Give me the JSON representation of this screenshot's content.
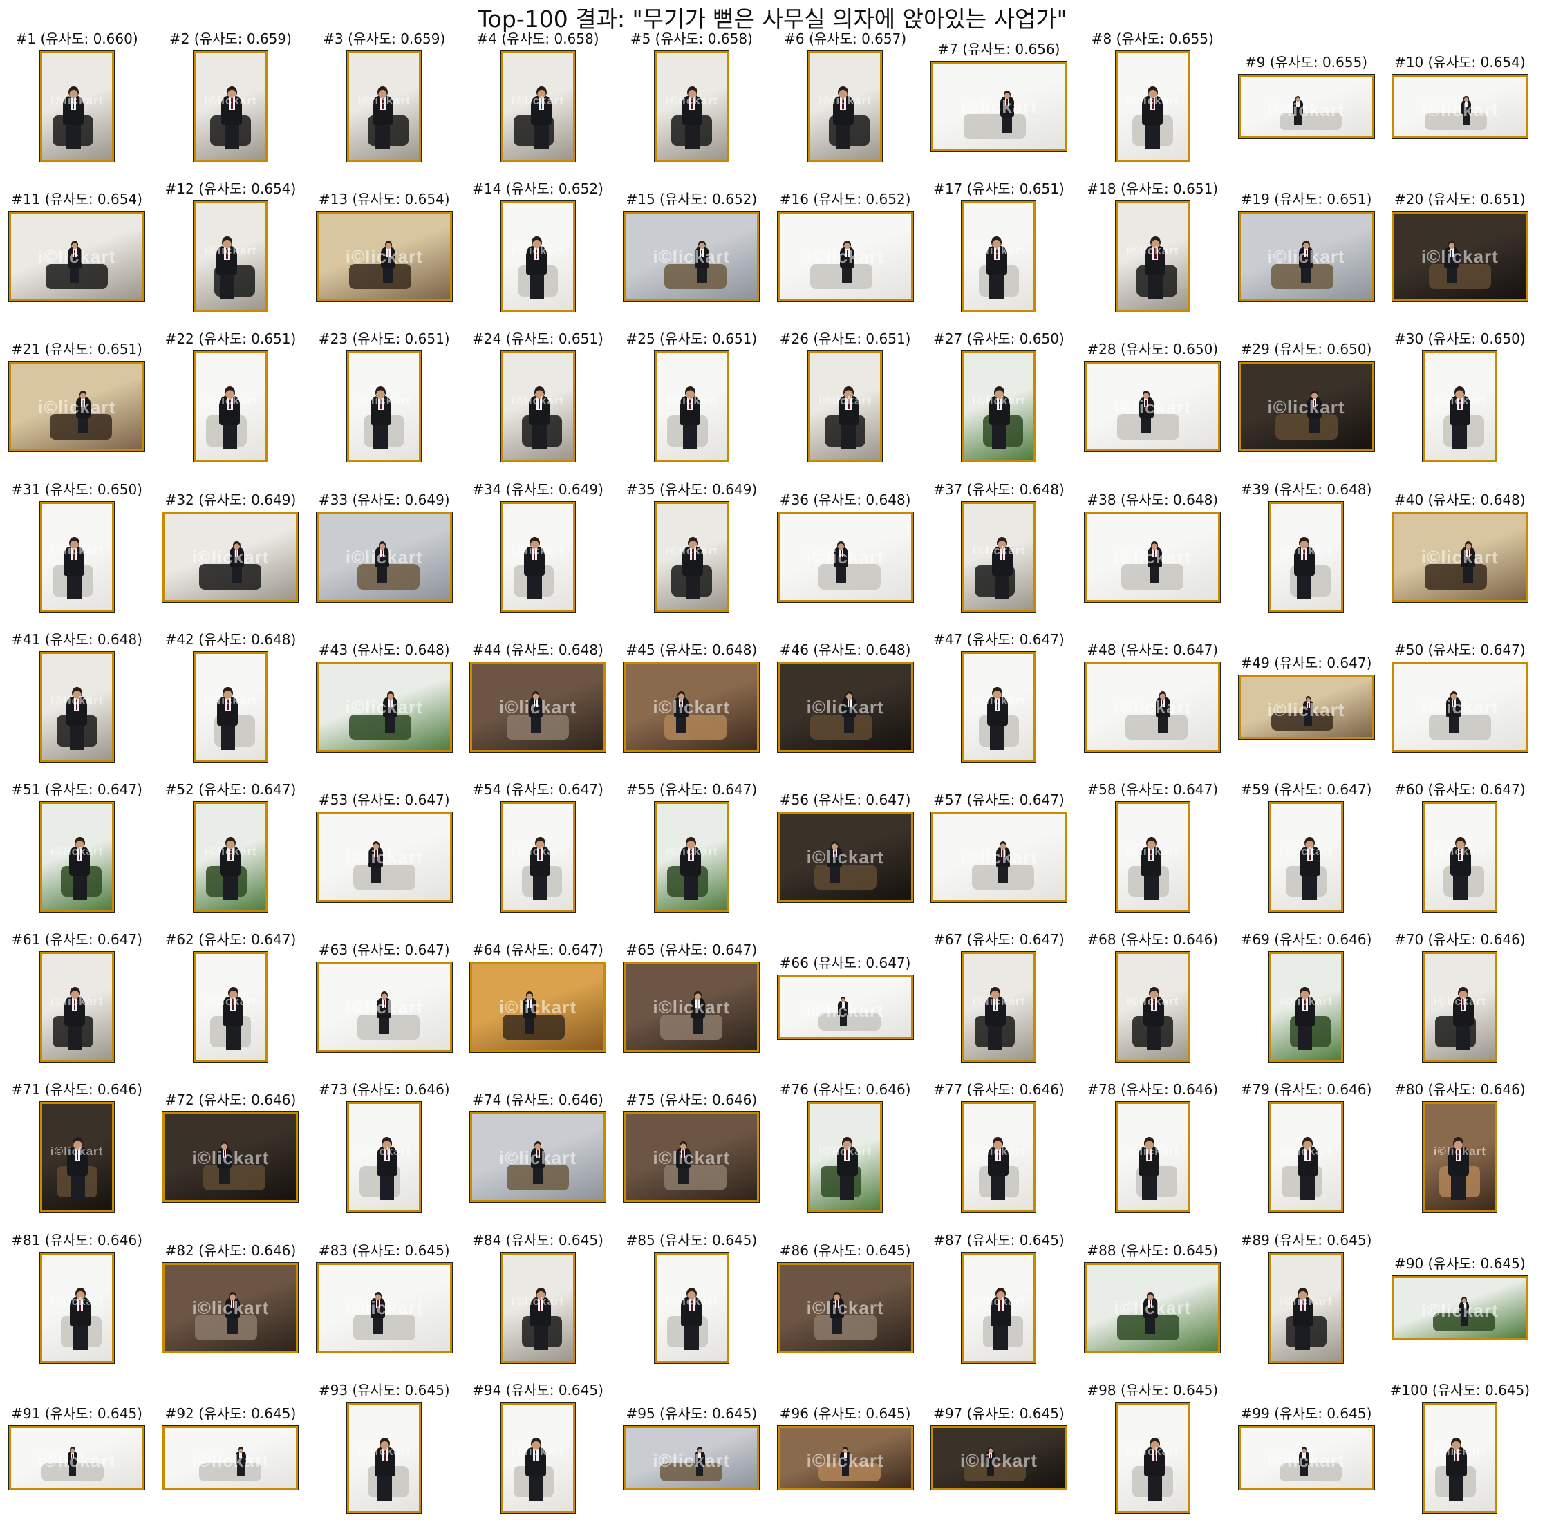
{
  "title": "Top-100 결과: \"무기가 뻗은 사무실 의자에 앉아있는 사업가\"",
  "caption_prefix": "유사도",
  "watermark": "i©lickart",
  "accent_border": "#c98a00",
  "results": [
    {
      "rank": 1,
      "score": "0.660",
      "orient": "p",
      "theme": "studio",
      "label": "#1 (유사도: 0.660)"
    },
    {
      "rank": 2,
      "score": "0.659",
      "orient": "p",
      "theme": "studio",
      "label": "#2 (유사도: 0.659)"
    },
    {
      "rank": 3,
      "score": "0.659",
      "orient": "p",
      "theme": "studio",
      "label": "#3 (유사도: 0.659)"
    },
    {
      "rank": 4,
      "score": "0.658",
      "orient": "p",
      "theme": "studio",
      "label": "#4 (유사도: 0.658)"
    },
    {
      "rank": 5,
      "score": "0.658",
      "orient": "p",
      "theme": "studio",
      "label": "#5 (유사도: 0.658)"
    },
    {
      "rank": 6,
      "score": "0.657",
      "orient": "p",
      "theme": "studio",
      "label": "#6 (유사도: 0.657)"
    },
    {
      "rank": 7,
      "score": "0.656",
      "orient": "l",
      "theme": "white",
      "label": "#7 (유사도: 0.656)"
    },
    {
      "rank": 8,
      "score": "0.655",
      "orient": "p",
      "theme": "white",
      "label": "#8 (유사도: 0.655)"
    },
    {
      "rank": 9,
      "score": "0.655",
      "orient": "w",
      "theme": "white",
      "label": "#9 (유사도: 0.655)"
    },
    {
      "rank": 10,
      "score": "0.654",
      "orient": "w",
      "theme": "white",
      "label": "#10 (유사도: 0.654)"
    },
    {
      "rank": 11,
      "score": "0.654",
      "orient": "l",
      "theme": "studio",
      "label": "#11 (유사도: 0.654)"
    },
    {
      "rank": 12,
      "score": "0.654",
      "orient": "p",
      "theme": "studio",
      "label": "#12 (유사도: 0.654)"
    },
    {
      "rank": 13,
      "score": "0.654",
      "orient": "l",
      "theme": "warm",
      "label": "#13 (유사도: 0.654)"
    },
    {
      "rank": 14,
      "score": "0.652",
      "orient": "p",
      "theme": "white",
      "label": "#14 (유사도: 0.652)"
    },
    {
      "rank": 15,
      "score": "0.652",
      "orient": "l",
      "theme": "grey",
      "label": "#15 (유사도: 0.652)"
    },
    {
      "rank": 16,
      "score": "0.652",
      "orient": "l",
      "theme": "white",
      "label": "#16 (유사도: 0.652)"
    },
    {
      "rank": 17,
      "score": "0.651",
      "orient": "p",
      "theme": "white",
      "label": "#17 (유사도: 0.651)"
    },
    {
      "rank": 18,
      "score": "0.651",
      "orient": "p",
      "theme": "studio",
      "label": "#18 (유사도: 0.651)"
    },
    {
      "rank": 19,
      "score": "0.651",
      "orient": "l",
      "theme": "grey",
      "label": "#19 (유사도: 0.651)"
    },
    {
      "rank": 20,
      "score": "0.651",
      "orient": "l",
      "theme": "dark",
      "label": "#20 (유사도: 0.651)"
    },
    {
      "rank": 21,
      "score": "0.651",
      "orient": "l",
      "theme": "warm",
      "label": "#21 (유사도: 0.651)"
    },
    {
      "rank": 22,
      "score": "0.651",
      "orient": "p",
      "theme": "white",
      "label": "#22 (유사도: 0.651)"
    },
    {
      "rank": 23,
      "score": "0.651",
      "orient": "p",
      "theme": "white",
      "label": "#23 (유사도: 0.651)"
    },
    {
      "rank": 24,
      "score": "0.651",
      "orient": "p",
      "theme": "studio",
      "label": "#24 (유사도: 0.651)"
    },
    {
      "rank": 25,
      "score": "0.651",
      "orient": "p",
      "theme": "white",
      "label": "#25 (유사도: 0.651)"
    },
    {
      "rank": 26,
      "score": "0.651",
      "orient": "p",
      "theme": "studio",
      "label": "#26 (유사도: 0.651)"
    },
    {
      "rank": 27,
      "score": "0.650",
      "orient": "p",
      "theme": "green",
      "label": "#27 (유사도: 0.650)"
    },
    {
      "rank": 28,
      "score": "0.650",
      "orient": "l",
      "theme": "white",
      "label": "#28 (유사도: 0.650)"
    },
    {
      "rank": 29,
      "score": "0.650",
      "orient": "l",
      "theme": "dark",
      "label": "#29 (유사도: 0.650)"
    },
    {
      "rank": 30,
      "score": "0.650",
      "orient": "p",
      "theme": "white",
      "label": "#30 (유사도: 0.650)"
    },
    {
      "rank": 31,
      "score": "0.650",
      "orient": "p",
      "theme": "white",
      "label": "#31 (유사도: 0.650)"
    },
    {
      "rank": 32,
      "score": "0.649",
      "orient": "l",
      "theme": "studio",
      "label": "#32 (유사도: 0.649)"
    },
    {
      "rank": 33,
      "score": "0.649",
      "orient": "l",
      "theme": "grey",
      "label": "#33 (유사도: 0.649)"
    },
    {
      "rank": 34,
      "score": "0.649",
      "orient": "p",
      "theme": "white",
      "label": "#34 (유사도: 0.649)"
    },
    {
      "rank": 35,
      "score": "0.649",
      "orient": "p",
      "theme": "studio",
      "label": "#35 (유사도: 0.649)"
    },
    {
      "rank": 36,
      "score": "0.648",
      "orient": "l",
      "theme": "white",
      "label": "#36 (유사도: 0.648)"
    },
    {
      "rank": 37,
      "score": "0.648",
      "orient": "p",
      "theme": "studio",
      "label": "#37 (유사도: 0.648)"
    },
    {
      "rank": 38,
      "score": "0.648",
      "orient": "l",
      "theme": "white",
      "label": "#38 (유사도: 0.648)"
    },
    {
      "rank": 39,
      "score": "0.648",
      "orient": "p",
      "theme": "white",
      "label": "#39 (유사도: 0.648)"
    },
    {
      "rank": 40,
      "score": "0.648",
      "orient": "l",
      "theme": "warm",
      "label": "#40 (유사도: 0.648)"
    },
    {
      "rank": 41,
      "score": "0.648",
      "orient": "p",
      "theme": "studio",
      "label": "#41 (유사도: 0.648)"
    },
    {
      "rank": 42,
      "score": "0.648",
      "orient": "p",
      "theme": "white",
      "label": "#42 (유사도: 0.648)"
    },
    {
      "rank": 43,
      "score": "0.648",
      "orient": "l",
      "theme": "green",
      "label": "#43 (유사도: 0.648)"
    },
    {
      "rank": 44,
      "score": "0.648",
      "orient": "l",
      "theme": "brick",
      "label": "#44 (유사도: 0.648)"
    },
    {
      "rank": 45,
      "score": "0.648",
      "orient": "l",
      "theme": "brown",
      "label": "#45 (유사도: 0.648)"
    },
    {
      "rank": 46,
      "score": "0.648",
      "orient": "l",
      "theme": "dark",
      "label": "#46 (유사도: 0.648)"
    },
    {
      "rank": 47,
      "score": "0.647",
      "orient": "p",
      "theme": "white",
      "label": "#47 (유사도: 0.647)"
    },
    {
      "rank": 48,
      "score": "0.647",
      "orient": "l",
      "theme": "white",
      "label": "#48 (유사도: 0.647)"
    },
    {
      "rank": 49,
      "score": "0.647",
      "orient": "w",
      "theme": "warm",
      "label": "#49 (유사도: 0.647)"
    },
    {
      "rank": 50,
      "score": "0.647",
      "orient": "l",
      "theme": "white",
      "label": "#50 (유사도: 0.647)"
    },
    {
      "rank": 51,
      "score": "0.647",
      "orient": "p",
      "theme": "green",
      "label": "#51 (유사도: 0.647)"
    },
    {
      "rank": 52,
      "score": "0.647",
      "orient": "p",
      "theme": "green",
      "label": "#52 (유사도: 0.647)"
    },
    {
      "rank": 53,
      "score": "0.647",
      "orient": "l",
      "theme": "white",
      "label": "#53 (유사도: 0.647)"
    },
    {
      "rank": 54,
      "score": "0.647",
      "orient": "p",
      "theme": "white",
      "label": "#54 (유사도: 0.647)"
    },
    {
      "rank": 55,
      "score": "0.647",
      "orient": "p",
      "theme": "green",
      "label": "#55 (유사도: 0.647)"
    },
    {
      "rank": 56,
      "score": "0.647",
      "orient": "l",
      "theme": "dark",
      "label": "#56 (유사도: 0.647)"
    },
    {
      "rank": 57,
      "score": "0.647",
      "orient": "l",
      "theme": "white",
      "label": "#57 (유사도: 0.647)"
    },
    {
      "rank": 58,
      "score": "0.647",
      "orient": "p",
      "theme": "white",
      "label": "#58 (유사도: 0.647)"
    },
    {
      "rank": 59,
      "score": "0.647",
      "orient": "p",
      "theme": "white",
      "label": "#59 (유사도: 0.647)"
    },
    {
      "rank": 60,
      "score": "0.647",
      "orient": "p",
      "theme": "white",
      "label": "#60 (유사도: 0.647)"
    },
    {
      "rank": 61,
      "score": "0.647",
      "orient": "p",
      "theme": "studio",
      "label": "#61 (유사도: 0.647)"
    },
    {
      "rank": 62,
      "score": "0.647",
      "orient": "p",
      "theme": "white",
      "label": "#62 (유사도: 0.647)"
    },
    {
      "rank": 63,
      "score": "0.647",
      "orient": "l",
      "theme": "white",
      "label": "#63 (유사도: 0.647)"
    },
    {
      "rank": 64,
      "score": "0.647",
      "orient": "l",
      "theme": "orange",
      "label": "#64 (유사도: 0.647)"
    },
    {
      "rank": 65,
      "score": "0.647",
      "orient": "l",
      "theme": "brick",
      "label": "#65 (유사도: 0.647)"
    },
    {
      "rank": 66,
      "score": "0.647",
      "orient": "w",
      "theme": "white",
      "label": "#66 (유사도: 0.647)"
    },
    {
      "rank": 67,
      "score": "0.647",
      "orient": "p",
      "theme": "studio",
      "label": "#67 (유사도: 0.647)"
    },
    {
      "rank": 68,
      "score": "0.646",
      "orient": "p",
      "theme": "studio",
      "label": "#68 (유사도: 0.646)"
    },
    {
      "rank": 69,
      "score": "0.646",
      "orient": "p",
      "theme": "green",
      "label": "#69 (유사도: 0.646)"
    },
    {
      "rank": 70,
      "score": "0.646",
      "orient": "p",
      "theme": "studio",
      "label": "#70 (유사도: 0.646)"
    },
    {
      "rank": 71,
      "score": "0.646",
      "orient": "p",
      "theme": "dark",
      "label": "#71 (유사도: 0.646)"
    },
    {
      "rank": 72,
      "score": "0.646",
      "orient": "l",
      "theme": "dark",
      "label": "#72 (유사도: 0.646)"
    },
    {
      "rank": 73,
      "score": "0.646",
      "orient": "p",
      "theme": "white",
      "label": "#73 (유사도: 0.646)"
    },
    {
      "rank": 74,
      "score": "0.646",
      "orient": "l",
      "theme": "grey",
      "label": "#74 (유사도: 0.646)"
    },
    {
      "rank": 75,
      "score": "0.646",
      "orient": "l",
      "theme": "brick",
      "label": "#75 (유사도: 0.646)"
    },
    {
      "rank": 76,
      "score": "0.646",
      "orient": "p",
      "theme": "green",
      "label": "#76 (유사도: 0.646)"
    },
    {
      "rank": 77,
      "score": "0.646",
      "orient": "p",
      "theme": "white",
      "label": "#77 (유사도: 0.646)"
    },
    {
      "rank": 78,
      "score": "0.646",
      "orient": "p",
      "theme": "white",
      "label": "#78 (유사도: 0.646)"
    },
    {
      "rank": 79,
      "score": "0.646",
      "orient": "p",
      "theme": "white",
      "label": "#79 (유사도: 0.646)"
    },
    {
      "rank": 80,
      "score": "0.646",
      "orient": "p",
      "theme": "brown",
      "label": "#80 (유사도: 0.646)"
    },
    {
      "rank": 81,
      "score": "0.646",
      "orient": "p",
      "theme": "white",
      "label": "#81 (유사도: 0.646)"
    },
    {
      "rank": 82,
      "score": "0.646",
      "orient": "l",
      "theme": "brick",
      "label": "#82 (유사도: 0.646)"
    },
    {
      "rank": 83,
      "score": "0.645",
      "orient": "l",
      "theme": "white",
      "label": "#83 (유사도: 0.645)"
    },
    {
      "rank": 84,
      "score": "0.645",
      "orient": "p",
      "theme": "studio",
      "label": "#84 (유사도: 0.645)"
    },
    {
      "rank": 85,
      "score": "0.645",
      "orient": "p",
      "theme": "white",
      "label": "#85 (유사도: 0.645)"
    },
    {
      "rank": 86,
      "score": "0.645",
      "orient": "l",
      "theme": "brick",
      "label": "#86 (유사도: 0.645)"
    },
    {
      "rank": 87,
      "score": "0.645",
      "orient": "p",
      "theme": "white",
      "label": "#87 (유사도: 0.645)"
    },
    {
      "rank": 88,
      "score": "0.645",
      "orient": "l",
      "theme": "green",
      "label": "#88 (유사도: 0.645)"
    },
    {
      "rank": 89,
      "score": "0.645",
      "orient": "p",
      "theme": "studio",
      "label": "#89 (유사도: 0.645)"
    },
    {
      "rank": 90,
      "score": "0.645",
      "orient": "w",
      "theme": "green",
      "label": "#90 (유사도: 0.645)"
    },
    {
      "rank": 91,
      "score": "0.645",
      "orient": "w",
      "theme": "white",
      "label": "#91 (유사도: 0.645)"
    },
    {
      "rank": 92,
      "score": "0.645",
      "orient": "w",
      "theme": "white",
      "label": "#92 (유사도: 0.645)"
    },
    {
      "rank": 93,
      "score": "0.645",
      "orient": "p",
      "theme": "white",
      "label": "#93 (유사도: 0.645)"
    },
    {
      "rank": 94,
      "score": "0.645",
      "orient": "p",
      "theme": "white",
      "label": "#94 (유사도: 0.645)"
    },
    {
      "rank": 95,
      "score": "0.645",
      "orient": "w",
      "theme": "grey",
      "label": "#95 (유사도: 0.645)"
    },
    {
      "rank": 96,
      "score": "0.645",
      "orient": "w",
      "theme": "brown",
      "label": "#96 (유사도: 0.645)"
    },
    {
      "rank": 97,
      "score": "0.645",
      "orient": "w",
      "theme": "dark",
      "label": "#97 (유사도: 0.645)"
    },
    {
      "rank": 98,
      "score": "0.645",
      "orient": "p",
      "theme": "white",
      "label": "#98 (유사도: 0.645)"
    },
    {
      "rank": 99,
      "score": "0.645",
      "orient": "w",
      "theme": "white",
      "label": "#99 (유사도: 0.645)"
    },
    {
      "rank": 100,
      "score": "0.645",
      "orient": "p",
      "theme": "white",
      "label": "#100 (유사도: 0.645)"
    }
  ]
}
